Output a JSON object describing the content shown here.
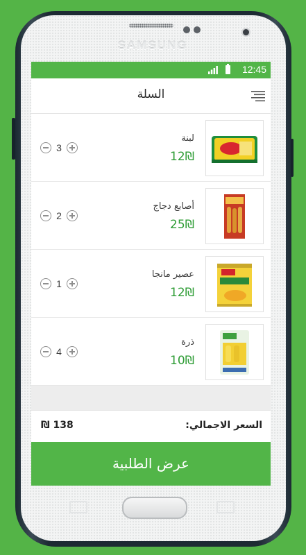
{
  "device": {
    "brand": "SAMSUNG"
  },
  "status_bar": {
    "time": "12:45",
    "signal_icon": "signal-icon",
    "battery_icon": "battery-icon"
  },
  "header": {
    "title": "السلة",
    "menu_icon": "menu-icon"
  },
  "cart": {
    "items": [
      {
        "name": "لبنة",
        "price": "12₪",
        "quantity": "3",
        "thumbnail": "labneh-package"
      },
      {
        "name": "أصابع دجاج",
        "price": "25₪",
        "quantity": "2",
        "thumbnail": "chicken-fingers-box"
      },
      {
        "name": "عصير مانجا",
        "price": "12₪",
        "quantity": "1",
        "thumbnail": "mango-pulp-can"
      },
      {
        "name": "ذرة",
        "price": "10₪",
        "quantity": "4",
        "thumbnail": "sweet-corn-bag"
      }
    ]
  },
  "summary": {
    "total_label": "السعر الاجمالي:",
    "total_value": "138 ₪"
  },
  "actions": {
    "order_label": "عرض الطلبية"
  },
  "colors": {
    "accent": "#52b548",
    "background": "#54b447",
    "price": "#2e9c35"
  }
}
